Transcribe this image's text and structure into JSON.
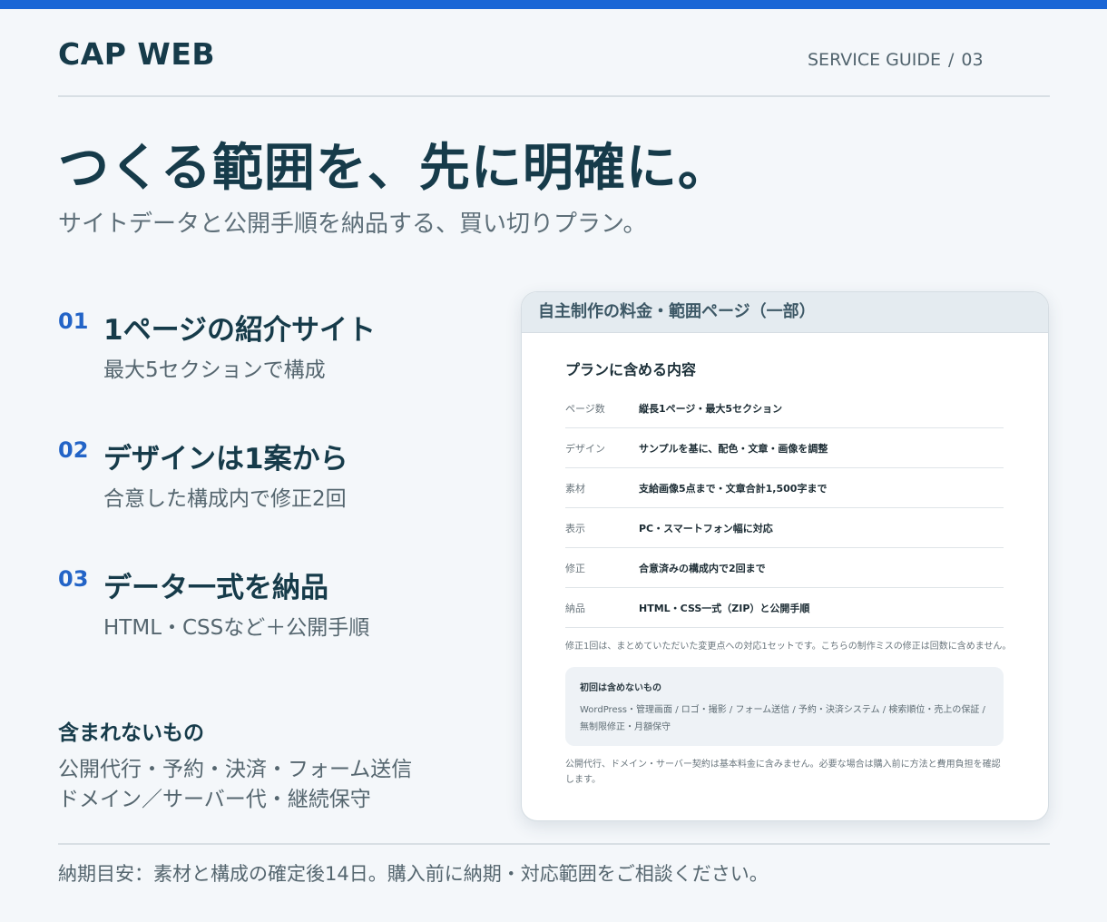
{
  "header": {
    "brand": "CAP WEB",
    "guide_label": "SERVICE GUIDE",
    "guide_sep": "/",
    "guide_page": "03"
  },
  "hero": {
    "headline": "つくる範囲を、先に明確に。",
    "subline": "サイトデータと公開手順を納品する、買い切りプラン。"
  },
  "features": [
    {
      "num": "01",
      "title": "1ページの紹介サイト",
      "desc": "最大5セクションで構成"
    },
    {
      "num": "02",
      "title": "デザインは1案から",
      "desc": "合意した構成内で修正2回"
    },
    {
      "num": "03",
      "title": "データ一式を納品",
      "desc": "HTML・CSSなど＋公開手順"
    }
  ],
  "excluded": {
    "title": "含まれないもの",
    "line1": "公開代行・予約・決済・フォーム送信",
    "line2": "ドメイン／サーバー代・継続保守"
  },
  "footer": {
    "text": "納期目安：素材と構成の確定後14日。購入前に納期・対応範囲をご相談ください。"
  },
  "panel": {
    "header": "自主制作の料金・範囲ページ（一部）",
    "plan_title": "プランに含める内容",
    "rows": [
      {
        "key": "ページ数",
        "value": "縦長1ページ・最大5セクション"
      },
      {
        "key": "デザイン",
        "value": "サンプルを基に、配色・文章・画像を調整"
      },
      {
        "key": "素材",
        "value": "支給画像5点まで・文章合計1,500字まで"
      },
      {
        "key": "表示",
        "value": "PC・スマートフォン幅に対応"
      },
      {
        "key": "修正",
        "value": "合意済みの構成内で2回まで"
      },
      {
        "key": "納品",
        "value": "HTML・CSS一式（ZIP）と公開手順"
      }
    ],
    "note1": "修正1回は、まとめていただいた変更点への対応1セットです。こちらの制作ミスの修正は回数に含めません。",
    "not_included_title": "初回は含めないもの",
    "not_included_body": "WordPress・管理画面 / ロゴ・撮影 / フォーム送信 / 予約・決済システム / 検索順位・売上の保証 / 無制限修正・月額保守",
    "note2": "公開代行、ドメイン・サーバー契約は基本料金に含みません。必要な場合は購入前に方法と費用負担を確認します。"
  },
  "colors": {
    "accent": "#1a66d6",
    "number": "#2364c7",
    "heading": "#163b4a",
    "body": "#55666f",
    "background": "#f4f7fa"
  }
}
